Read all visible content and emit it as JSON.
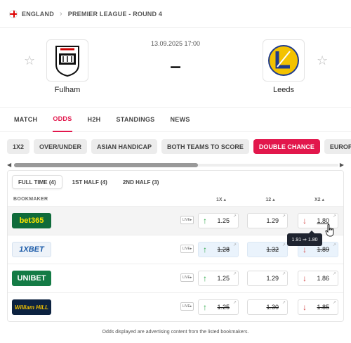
{
  "breadcrumb": {
    "country": "ENGLAND",
    "league": "PREMIER LEAGUE - ROUND 4"
  },
  "match": {
    "datetime": "13.09.2025 17:00",
    "score": "–",
    "home": {
      "name": "Fulham",
      "logo_icon": "fulham-crest-icon"
    },
    "away": {
      "name": "Leeds",
      "logo_icon": "leeds-crest-icon"
    }
  },
  "tabs": [
    {
      "label": "MATCH",
      "active": false
    },
    {
      "label": "ODDS",
      "active": true
    },
    {
      "label": "H2H",
      "active": false
    },
    {
      "label": "STANDINGS",
      "active": false
    },
    {
      "label": "NEWS",
      "active": false
    }
  ],
  "markets": [
    {
      "label": "1X2",
      "active": false
    },
    {
      "label": "OVER/UNDER",
      "active": false
    },
    {
      "label": "ASIAN HANDICAP",
      "active": false
    },
    {
      "label": "BOTH TEAMS TO SCORE",
      "active": false
    },
    {
      "label": "DOUBLE CHANCE",
      "active": true
    },
    {
      "label": "EUROPEAN",
      "active": false
    }
  ],
  "periods": [
    {
      "label": "FULL TIME (4)",
      "active": true
    },
    {
      "label": "1ST HALF (4)",
      "active": false
    },
    {
      "label": "2ND HALF (3)",
      "active": false
    }
  ],
  "table": {
    "headers": {
      "bookmaker": "BOOKMAKER",
      "c1": "1X ▴",
      "c2": "12 ▴",
      "c3": "X2 ▴"
    },
    "live_label": "LIVE▸",
    "rows": [
      {
        "bookmaker": "bet365",
        "c1": "1.25",
        "c2": "1.29",
        "c3": "1.80"
      },
      {
        "bookmaker": "1XBET",
        "c1": "1.28",
        "c2": "1.32",
        "c3": "1.89"
      },
      {
        "bookmaker": "UNIBET",
        "c1": "1.25",
        "c2": "1.29",
        "c3": "1.86"
      },
      {
        "bookmaker": "William HILL",
        "c1": "1.25",
        "c2": "1.30",
        "c3": "1.85"
      }
    ]
  },
  "tooltip": "1.91 ⇒ 1.80",
  "footer": "Odds displayed are advertising content from the listed bookmakers.",
  "colors": {
    "accent": "#e2174c",
    "up": "#2ea84a",
    "down": "#d24848"
  }
}
